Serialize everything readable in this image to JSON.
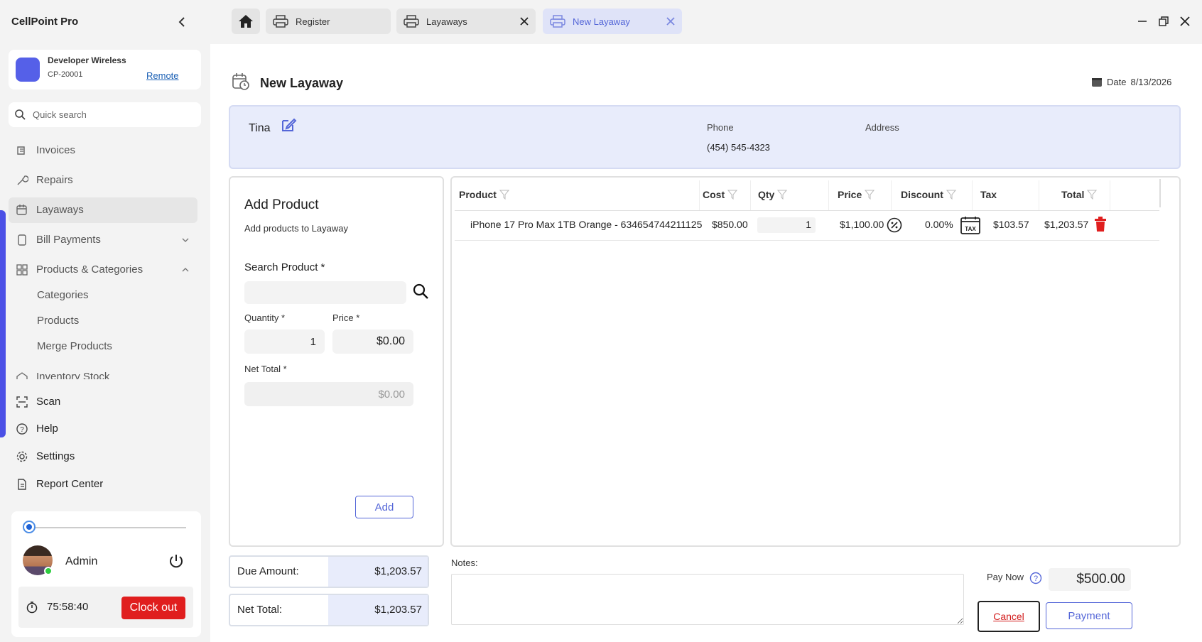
{
  "app": {
    "title": "CellPoint Pro"
  },
  "store": {
    "name": "Developer Wireless",
    "code": "CP-20001",
    "link": "Remote"
  },
  "sidebar": {
    "search_placeholder": "Quick search",
    "items": [
      {
        "label": "Invoices",
        "icon": "invoice-icon"
      },
      {
        "label": "Repairs",
        "icon": "wrench-icon"
      },
      {
        "label": "Layaways",
        "icon": "layaway-icon"
      },
      {
        "label": "Bill Payments",
        "icon": "bill-icon"
      },
      {
        "label": "Products & Categories",
        "icon": "products-icon"
      },
      {
        "label": "Categories"
      },
      {
        "label": "Products"
      },
      {
        "label": "Merge Products"
      },
      {
        "label": "Inventory Stock",
        "icon": "inventory-icon"
      },
      {
        "label": "Scan",
        "icon": "scan-icon"
      },
      {
        "label": "Help",
        "icon": "help-icon"
      },
      {
        "label": "Settings",
        "icon": "gear-icon"
      },
      {
        "label": "Report Center",
        "icon": "report-icon"
      }
    ]
  },
  "user": {
    "name": "Admin",
    "timer": "75:58:40",
    "clockout_label": "Clock out"
  },
  "tabs": [
    {
      "label": "Register"
    },
    {
      "label": "Layaways"
    },
    {
      "label": "New Layaway"
    }
  ],
  "page": {
    "title": "New Layaway",
    "date_label": "Date",
    "date": "8/13/2026"
  },
  "customer": {
    "name": "Tina",
    "phone_label": "Phone",
    "phone": "(454) 545-4323",
    "address_label": "Address"
  },
  "add_product": {
    "title": "Add Product",
    "subtitle": "Add products to Layaway",
    "search_label": "Search Product *",
    "quantity_label": "Quantity *",
    "quantity": "1",
    "price_label": "Price *",
    "price": "$0.00",
    "net_total_label": "Net Total *",
    "net_total": "$0.00",
    "add_label": "Add"
  },
  "table": {
    "columns": [
      "Product",
      "Cost",
      "Qty",
      "Price",
      "Discount",
      "Tax",
      "Total"
    ],
    "rows": [
      {
        "product": "iPhone 17 Pro Max 1TB Orange - 634654744211125",
        "cost": "$850.00",
        "qty": "1",
        "price": "$1,100.00",
        "discount": "0.00%",
        "tax": "$103.57",
        "total": "$1,203.57"
      }
    ]
  },
  "summary": {
    "due_label": "Due Amount:",
    "due": "$1,203.57",
    "net_label": "Net Total:",
    "net": "$1,203.57"
  },
  "notes_label": "Notes:",
  "payment": {
    "pay_now_label": "Pay Now",
    "pay_now": "$500.00",
    "cancel_label": "Cancel",
    "payment_label": "Payment"
  }
}
